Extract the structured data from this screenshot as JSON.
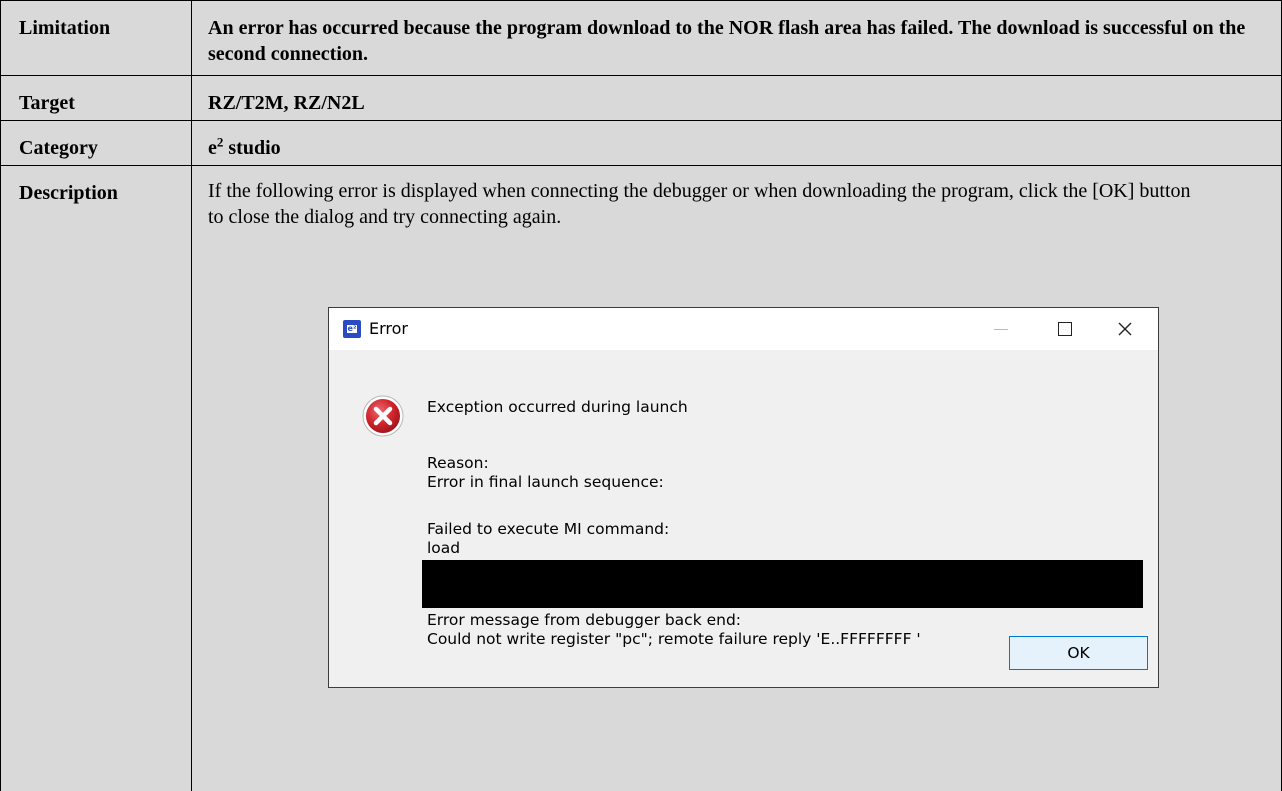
{
  "table": {
    "rows": [
      {
        "label": "Limitation",
        "value": "An error has occurred because the program download to the NOR flash area has failed. The download is successful on the second connection."
      },
      {
        "label": "Target",
        "value": "RZ/T2M, RZ/N2L"
      },
      {
        "label": "Category",
        "value_base": "e",
        "value_sup": "2",
        "value_rest": " studio"
      },
      {
        "label": "Description",
        "value": "If the following error is displayed when connecting the debugger or when downloading the program, click the [OK] button to close the dialog and try connecting again."
      }
    ]
  },
  "dialog": {
    "title": "Error",
    "heading": "Exception occurred during launch",
    "reason_label": "Reason:",
    "reason": "Error in final launch sequence:",
    "failed_label": "Failed to execute MI command:",
    "command": "load",
    "backend_label": "Error message from debugger back end:",
    "backend_message": "Could not write register \"pc\"; remote failure reply 'E..FFFFFFFF '",
    "ok_label": "OK",
    "icons": {
      "app": "e2-studio-app-icon",
      "error": "error-x-icon",
      "minimize": "minimize-icon",
      "maximize": "maximize-icon",
      "close": "close-icon"
    },
    "colors": {
      "error_red": "#c8232c",
      "ok_border": "#0078d7",
      "redaction": "#000000"
    }
  }
}
